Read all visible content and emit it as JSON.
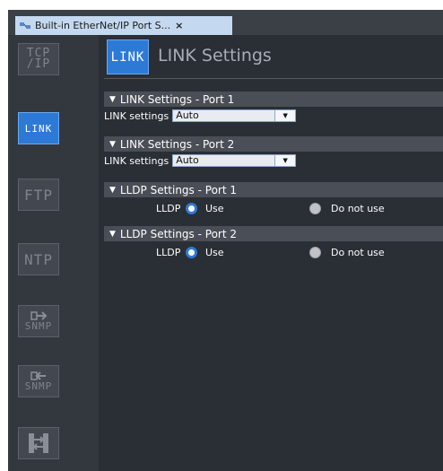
{
  "tab": {
    "title": "Built-in EtherNet/IP Port S...",
    "close_label": "×"
  },
  "sidebar": {
    "items": [
      {
        "label": "TCP\n/IP"
      },
      {
        "label": "LINK"
      },
      {
        "label": "FTP"
      },
      {
        "label": "NTP"
      },
      {
        "label": "SNMP"
      },
      {
        "label": "SNMP"
      }
    ]
  },
  "header": {
    "icon_label": "LINK",
    "title": "LINK Settings"
  },
  "sections": {
    "link_port1": {
      "title": "LINK Settings - Port 1",
      "field_label": "LINK settings",
      "value": "Auto"
    },
    "link_port2": {
      "title": "LINK Settings - Port 2",
      "field_label": "LINK settings",
      "value": "Auto"
    },
    "lldp_port1": {
      "title": "LLDP Settings - Port 1",
      "field_label": "LLDP",
      "option_use": "Use",
      "option_not": "Do not use",
      "selected": "Use"
    },
    "lldp_port2": {
      "title": "LLDP Settings - Port 2",
      "field_label": "LLDP",
      "option_use": "Use",
      "option_not": "Do not use",
      "selected": "Use"
    }
  },
  "colors": {
    "accent": "#2d7ad6",
    "background": "#2a2e35",
    "sidebar": "#33373e",
    "tab": "#c4d9f0"
  }
}
